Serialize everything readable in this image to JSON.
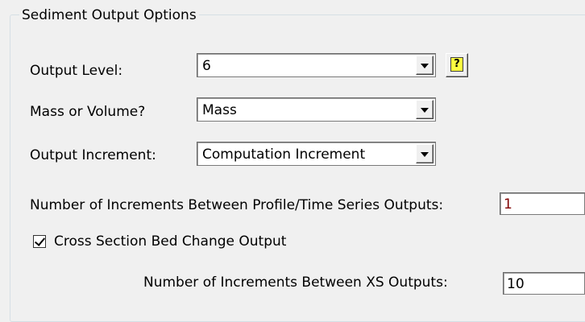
{
  "group": {
    "title": "Sediment Output Options"
  },
  "output_level": {
    "label": "Output Level:",
    "value": "6",
    "help_glyph": "?"
  },
  "mass_or_volume": {
    "label": "Mass or Volume?",
    "value": "Mass"
  },
  "output_increment": {
    "label": "Output Increment:",
    "value": "Computation Increment"
  },
  "profile_increments": {
    "label": "Number of Increments Between Profile/Time Series Outputs:",
    "value": "1"
  },
  "xs_bed_change": {
    "label": "Cross Section Bed Change Output",
    "checked": true
  },
  "xs_increments": {
    "label": "Number of Increments Between XS Outputs:",
    "value": "10"
  },
  "icons": {
    "dropdown": "chevron-down-icon",
    "help": "help-icon",
    "check": "check-icon"
  },
  "colors": {
    "background": "#f0f0f0",
    "textbox_value": "#800000",
    "help_icon_bg": "#ffff40"
  }
}
